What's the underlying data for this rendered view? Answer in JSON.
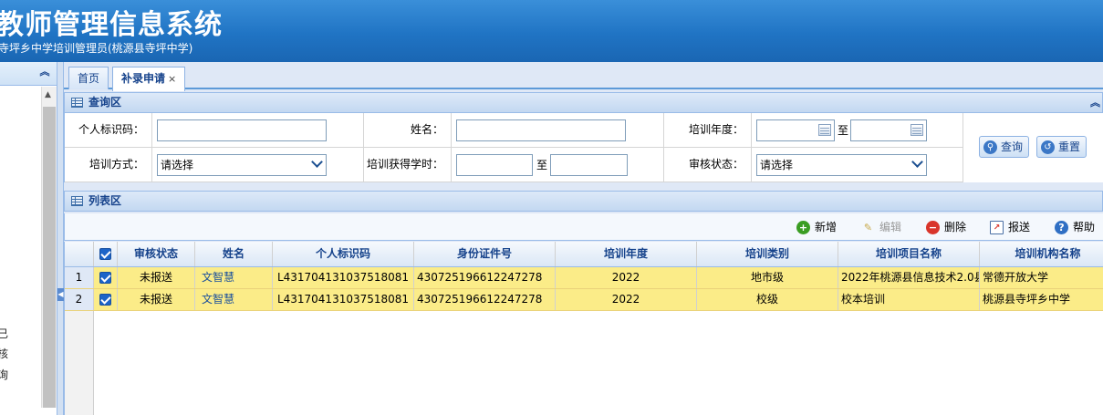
{
  "header": {
    "title": "教师管理信息系统",
    "subtitle": "寺坪乡中学培训管理员(桃源县寺坪中学)"
  },
  "left_panel": {
    "fragments": [
      "已",
      "核",
      "询"
    ]
  },
  "tabs": [
    {
      "label": "首页",
      "active": false
    },
    {
      "label": "补录申请",
      "active": true,
      "close": "×"
    }
  ],
  "query": {
    "title": "查询区",
    "fields": {
      "id_code_label": "个人标识码：",
      "id_code_value": "",
      "name_label": "姓名：",
      "name_value": "",
      "year_label": "培训年度：",
      "year_from": "",
      "year_to_label": "至",
      "year_to": "",
      "mode_label": "培训方式：",
      "mode_value": "请选择",
      "hours_label": "培训获得学时：",
      "hours_from": "",
      "hours_to_label": "至",
      "hours_to": "",
      "status_label": "审核状态：",
      "status_value": "请选择"
    },
    "buttons": {
      "search": "查询",
      "reset": "重置"
    }
  },
  "list": {
    "title": "列表区",
    "toolbar": {
      "add": "新增",
      "edit": "编辑",
      "delete": "删除",
      "submit": "报送",
      "help": "帮助"
    },
    "columns": [
      "审核状态",
      "姓名",
      "个人标识码",
      "身份证件号",
      "培训年度",
      "培训类别",
      "培训项目名称",
      "培训机构名称"
    ],
    "rows": [
      {
        "num": "1",
        "status": "未报送",
        "name": "文智慧",
        "id_code": "L431704131037518081",
        "id_card": "430725196612247278",
        "year": "2022",
        "category": "地市级",
        "project": "2022年桃源县信息技术2.0县",
        "org": "常德开放大学"
      },
      {
        "num": "2",
        "status": "未报送",
        "name": "文智慧",
        "id_code": "L431704131037518081",
        "id_card": "430725196612247278",
        "year": "2022",
        "category": "校级",
        "project": "校本培训",
        "org": "桃源县寺坪乡中学"
      }
    ]
  },
  "colors": {
    "header_blue": "#2074c4",
    "panel_title": "#15428b",
    "row_highlight": "#fbec88"
  }
}
